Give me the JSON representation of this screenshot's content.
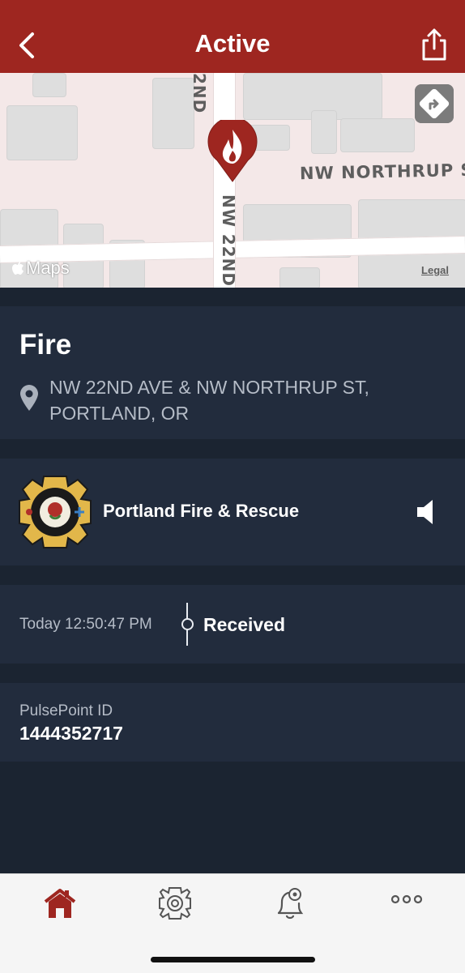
{
  "header": {
    "title": "Active",
    "back_icon": "chevron-left-icon",
    "share_icon": "share-icon",
    "background_color": "#9e2620"
  },
  "map": {
    "street_horizontal": "NW NORTHRUP S",
    "street_vertical_top": "2ND",
    "street_vertical_bottom": "NW 22ND",
    "maps_logo": "Maps",
    "legal": "Legal",
    "pin_icon": "fire-pin-icon",
    "directions_icon": "directions-icon"
  },
  "incident": {
    "type": "Fire",
    "address": "NW 22ND AVE & NW NORTHRUP ST, PORTLAND, OR",
    "location_icon": "location-pin-icon"
  },
  "agency": {
    "name": "Portland Fire & Rescue",
    "badge_icon": "portland-fire-rescue-badge",
    "speaker_icon": "speaker-icon"
  },
  "timeline": {
    "time": "Today 12:50:47 PM",
    "status": "Received"
  },
  "pulsepoint": {
    "label": "PulsePoint ID",
    "value": "1444352717"
  },
  "tabbar": {
    "items": [
      {
        "icon": "home-icon",
        "active": true
      },
      {
        "icon": "fire-department-icon",
        "active": false
      },
      {
        "icon": "alert-settings-icon",
        "active": false
      },
      {
        "icon": "more-icon",
        "active": false
      }
    ],
    "active_color": "#9e2620"
  }
}
